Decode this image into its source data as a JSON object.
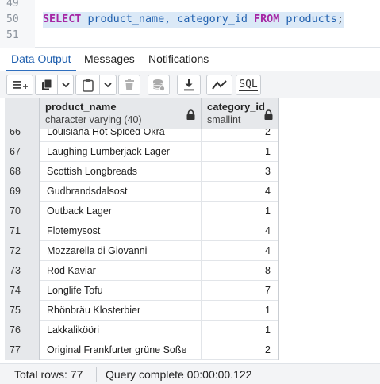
{
  "editor": {
    "lines": [
      {
        "number": "49",
        "code": ""
      },
      {
        "number": "50",
        "code": "SELECT product_name, category_id FROM products;"
      },
      {
        "number": "51",
        "code": ""
      }
    ],
    "query_tokens": {
      "select": "SELECT",
      "columns": "product_name, category_id",
      "from": "FROM",
      "table": "products",
      "terminator": ";"
    }
  },
  "tabs": [
    {
      "label": "Data Output",
      "active": true
    },
    {
      "label": "Messages",
      "active": false
    },
    {
      "label": "Notifications",
      "active": false
    }
  ],
  "toolbar": {
    "buttons": [
      "add-row-icon",
      "copy-icon",
      "chevron-down-icon",
      "paste-icon",
      "chevron-down-icon",
      "delete-icon",
      "save-data-icon",
      "download-icon",
      "graph-icon",
      "sql-icon"
    ],
    "sql_label": "SQL"
  },
  "grid": {
    "columns": [
      {
        "name": "product_name",
        "type": "character varying (40)"
      },
      {
        "name": "category_id",
        "type": "smallint"
      }
    ],
    "rows": [
      {
        "n": "66",
        "product_name": "Louisiana Hot Spiced Okra",
        "category_id": "2"
      },
      {
        "n": "67",
        "product_name": "Laughing Lumberjack Lager",
        "category_id": "1"
      },
      {
        "n": "68",
        "product_name": "Scottish Longbreads",
        "category_id": "3"
      },
      {
        "n": "69",
        "product_name": "Gudbrandsdalsost",
        "category_id": "4"
      },
      {
        "n": "70",
        "product_name": "Outback Lager",
        "category_id": "1"
      },
      {
        "n": "71",
        "product_name": "Flotemysost",
        "category_id": "4"
      },
      {
        "n": "72",
        "product_name": "Mozzarella di Giovanni",
        "category_id": "4"
      },
      {
        "n": "73",
        "product_name": "Röd Kaviar",
        "category_id": "8"
      },
      {
        "n": "74",
        "product_name": "Longlife Tofu",
        "category_id": "7"
      },
      {
        "n": "75",
        "product_name": "Rhönbräu Klosterbier",
        "category_id": "1"
      },
      {
        "n": "76",
        "product_name": "Lakkalikööri",
        "category_id": "1"
      },
      {
        "n": "77",
        "product_name": "Original Frankfurter grüne Soße",
        "category_id": "2"
      }
    ]
  },
  "status": {
    "total_rows": "Total rows: 77",
    "query_complete": "Query complete 00:00:00.122"
  },
  "colors": {
    "keyword": "#a626a4",
    "identifier": "#1f5fae",
    "active_tab": "#1f5fae",
    "line_highlight": "#dbe9f7"
  }
}
